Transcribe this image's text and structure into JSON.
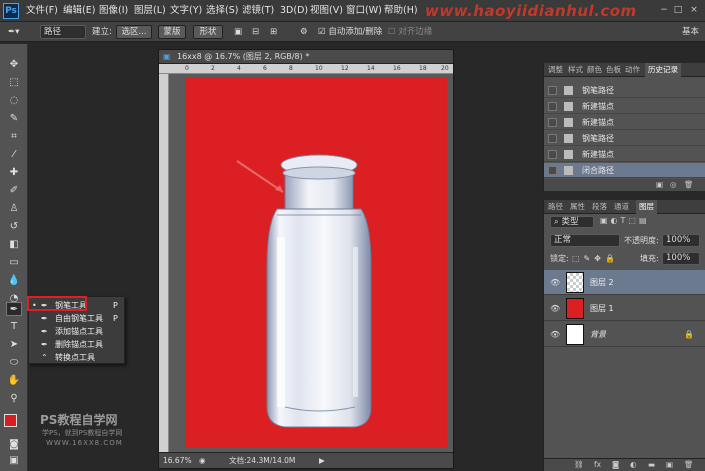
{
  "menubar": {
    "logo": "Ps",
    "items": [
      "文件(F)",
      "编辑(E)",
      "图像(I)",
      "图层(L)",
      "文字(Y)",
      "选择(S)",
      "滤镜(T)",
      "3D(D)",
      "视图(V)",
      "窗口(W)",
      "帮助(H)"
    ],
    "watermark": "www.haoyiidianhul.com",
    "window_controls": [
      "−",
      "□",
      "×"
    ]
  },
  "options": {
    "mode": "路径",
    "make_label": "建立:",
    "selection_button": "选区...",
    "mask_button": "蒙版",
    "shape_button": "形状",
    "auto_add_delete": "自动添加/删除",
    "align_edges": "对齐边缘",
    "workspace": "基本"
  },
  "toolbar": {
    "tools": [
      "move-icon",
      "marquee-icon",
      "lasso-icon",
      "quick-select-icon",
      "crop-icon",
      "eyedropper-icon",
      "healing-icon",
      "brush-icon",
      "stamp-icon",
      "history-brush-icon",
      "eraser-icon",
      "gradient-icon",
      "blur-icon",
      "dodge-icon",
      "pen-icon",
      "type-icon",
      "path-select-icon",
      "shape-icon",
      "hand-icon",
      "zoom-icon"
    ],
    "foreground": "#d81e22",
    "background": "#e0155a"
  },
  "flyout": {
    "items": [
      {
        "label": "钢笔工具",
        "key": "P",
        "active": true
      },
      {
        "label": "自由钢笔工具",
        "key": "P"
      },
      {
        "label": "添加锚点工具",
        "key": ""
      },
      {
        "label": "删除锚点工具",
        "key": ""
      },
      {
        "label": "转换点工具",
        "key": ""
      }
    ]
  },
  "document": {
    "title": "16xx8 @ 16.7% (图层 2, RGB/8) *",
    "ruler": [
      "0",
      "2",
      "4",
      "6",
      "8",
      "10",
      "12",
      "14",
      "16",
      "18",
      "20"
    ],
    "zoom": "16.67%",
    "status": "文档:24.3M/14.0M",
    "canvas_color": "#dc1f22"
  },
  "history": {
    "tabs": [
      "调整",
      "样式",
      "颜色",
      "色板",
      "动作",
      "历史记录"
    ],
    "rows": [
      "钢笔路径",
      "新建锚点",
      "新建锚点",
      "钢笔路径",
      "新建锚点",
      "闭合路径"
    ]
  },
  "layers": {
    "tabs": [
      "路径",
      "属性",
      "段落",
      "通道",
      "图层"
    ],
    "filter": "类型",
    "blend": "正常",
    "opacity_label": "不透明度:",
    "opacity": "100%",
    "lock_label": "锁定:",
    "fill_label": "填充:",
    "fill": "100%",
    "items": [
      {
        "name": "图层 2",
        "thumb": "checker",
        "selected": true
      },
      {
        "name": "图层 1",
        "thumb": "#dc1f22"
      },
      {
        "name": "背景",
        "thumb": "#ffffff",
        "locked": true
      }
    ],
    "bottom_icons": [
      "link-icon",
      "fx-icon",
      "mask-icon",
      "adjust-icon",
      "folder-icon",
      "new-layer-icon",
      "trash-icon"
    ]
  },
  "brand": {
    "title": "PS教程自学网",
    "line2": "学PS，就到PS教程自学网",
    "line3": "WWW.16XX8.COM"
  }
}
